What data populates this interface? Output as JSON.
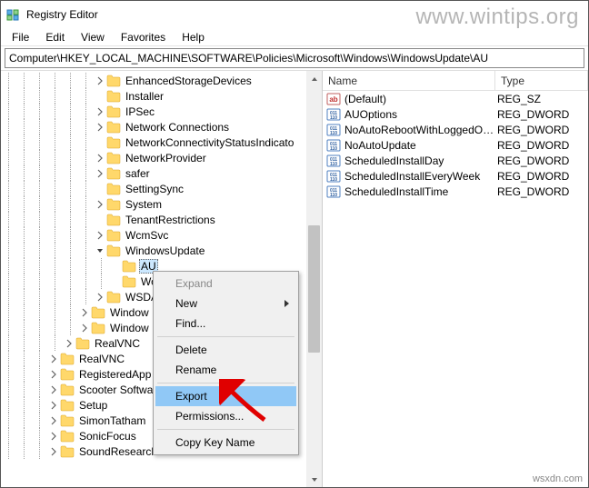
{
  "window": {
    "title": "Registry Editor"
  },
  "watermark": "www.wintips.org",
  "br_watermark": "wsxdn.com",
  "menus": [
    "File",
    "Edit",
    "View",
    "Favorites",
    "Help"
  ],
  "address": "Computer\\HKEY_LOCAL_MACHINE\\SOFTWARE\\Policies\\Microsoft\\Windows\\WindowsUpdate\\AU",
  "columns": {
    "name": "Name",
    "type": "Type"
  },
  "values": [
    {
      "icon": "string",
      "name": "(Default)",
      "type": "REG_SZ"
    },
    {
      "icon": "dword",
      "name": "AUOptions",
      "type": "REG_DWORD"
    },
    {
      "icon": "dword",
      "name": "NoAutoRebootWithLoggedOnU...",
      "type": "REG_DWORD"
    },
    {
      "icon": "dword",
      "name": "NoAutoUpdate",
      "type": "REG_DWORD"
    },
    {
      "icon": "dword",
      "name": "ScheduledInstallDay",
      "type": "REG_DWORD"
    },
    {
      "icon": "dword",
      "name": "ScheduledInstallEveryWeek",
      "type": "REG_DWORD"
    },
    {
      "icon": "dword",
      "name": "ScheduledInstallTime",
      "type": "REG_DWORD"
    }
  ],
  "tree": [
    {
      "depth": 6,
      "exp": ">",
      "label": "EnhancedStorageDevices"
    },
    {
      "depth": 6,
      "exp": "",
      "label": "Installer"
    },
    {
      "depth": 6,
      "exp": ">",
      "label": "IPSec"
    },
    {
      "depth": 6,
      "exp": ">",
      "label": "Network Connections"
    },
    {
      "depth": 6,
      "exp": "",
      "label": "NetworkConnectivityStatusIndicato"
    },
    {
      "depth": 6,
      "exp": ">",
      "label": "NetworkProvider"
    },
    {
      "depth": 6,
      "exp": ">",
      "label": "safer"
    },
    {
      "depth": 6,
      "exp": "",
      "label": "SettingSync"
    },
    {
      "depth": 6,
      "exp": ">",
      "label": "System"
    },
    {
      "depth": 6,
      "exp": "",
      "label": "TenantRestrictions"
    },
    {
      "depth": 6,
      "exp": ">",
      "label": "WcmSvc"
    },
    {
      "depth": 6,
      "exp": "v",
      "label": "WindowsUpdate"
    },
    {
      "depth": 7,
      "exp": "",
      "label": "AU",
      "selected": true
    },
    {
      "depth": 7,
      "exp": "",
      "label": "Work"
    },
    {
      "depth": 6,
      "exp": ">",
      "label": "WSDA"
    },
    {
      "depth": 5,
      "exp": ">",
      "label": "Window"
    },
    {
      "depth": 5,
      "exp": ">",
      "label": "Window"
    },
    {
      "depth": 4,
      "exp": ">",
      "label": "RealVNC"
    },
    {
      "depth": 3,
      "exp": ">",
      "label": "RealVNC"
    },
    {
      "depth": 3,
      "exp": ">",
      "label": "RegisteredApp"
    },
    {
      "depth": 3,
      "exp": ">",
      "label": "Scooter Softwa"
    },
    {
      "depth": 3,
      "exp": ">",
      "label": "Setup"
    },
    {
      "depth": 3,
      "exp": ">",
      "label": "SimonTatham"
    },
    {
      "depth": 3,
      "exp": ">",
      "label": "SonicFocus"
    },
    {
      "depth": 3,
      "exp": ">",
      "label": "SoundResearch"
    }
  ],
  "context_menu": {
    "items": [
      {
        "label": "Expand",
        "disabled": true
      },
      {
        "label": "New",
        "submenu": true
      },
      {
        "label": "Find..."
      },
      {
        "sep": true
      },
      {
        "label": "Delete"
      },
      {
        "label": "Rename"
      },
      {
        "sep": true
      },
      {
        "label": "Export",
        "hover": true
      },
      {
        "label": "Permissions..."
      },
      {
        "sep": true
      },
      {
        "label": "Copy Key Name"
      }
    ]
  }
}
